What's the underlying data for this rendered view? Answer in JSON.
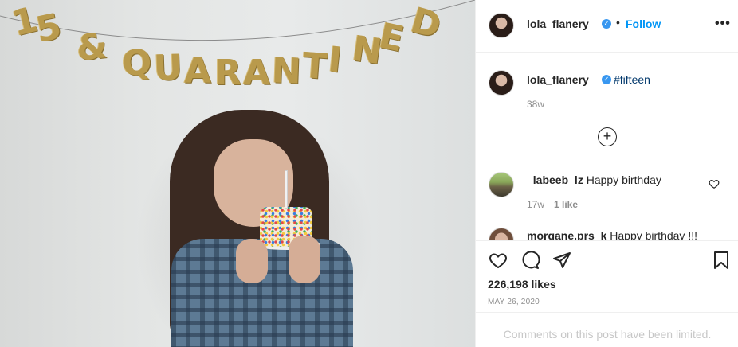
{
  "post": {
    "banner_text": [
      "1",
      "5",
      "&",
      "Q",
      "U",
      "A",
      "R",
      "A",
      "N",
      "T",
      "I",
      "N",
      "E",
      "D"
    ],
    "header": {
      "username": "lola_flanery",
      "separator": "•",
      "follow_label": "Follow",
      "more_label": "•••"
    },
    "caption": {
      "username": "lola_flanery",
      "text": "#fifteen",
      "age": "38w"
    },
    "load_more_label": "+",
    "comments": [
      {
        "username": "_labeeb_lz",
        "text": "Happy birthday",
        "age": "17w",
        "likes": "1 like"
      },
      {
        "username": "morgane.prs_k",
        "text": "Happy birthday !!!"
      }
    ],
    "likes": "226,198 likes",
    "date": "MAY 26, 2020",
    "comments_limited": "Comments on this post have been limited."
  },
  "icons": {
    "verified": "verified-badge-icon",
    "like": "heart-icon",
    "comment": "comment-icon",
    "share": "send-icon",
    "save": "bookmark-icon",
    "load_more": "plus-circle-icon"
  },
  "colors": {
    "link_blue": "#0095f6",
    "hashtag": "#00376b",
    "verified": "#3897f0",
    "secondary_text": "#8e8e8e",
    "banner_gold": "#b99a4c"
  }
}
